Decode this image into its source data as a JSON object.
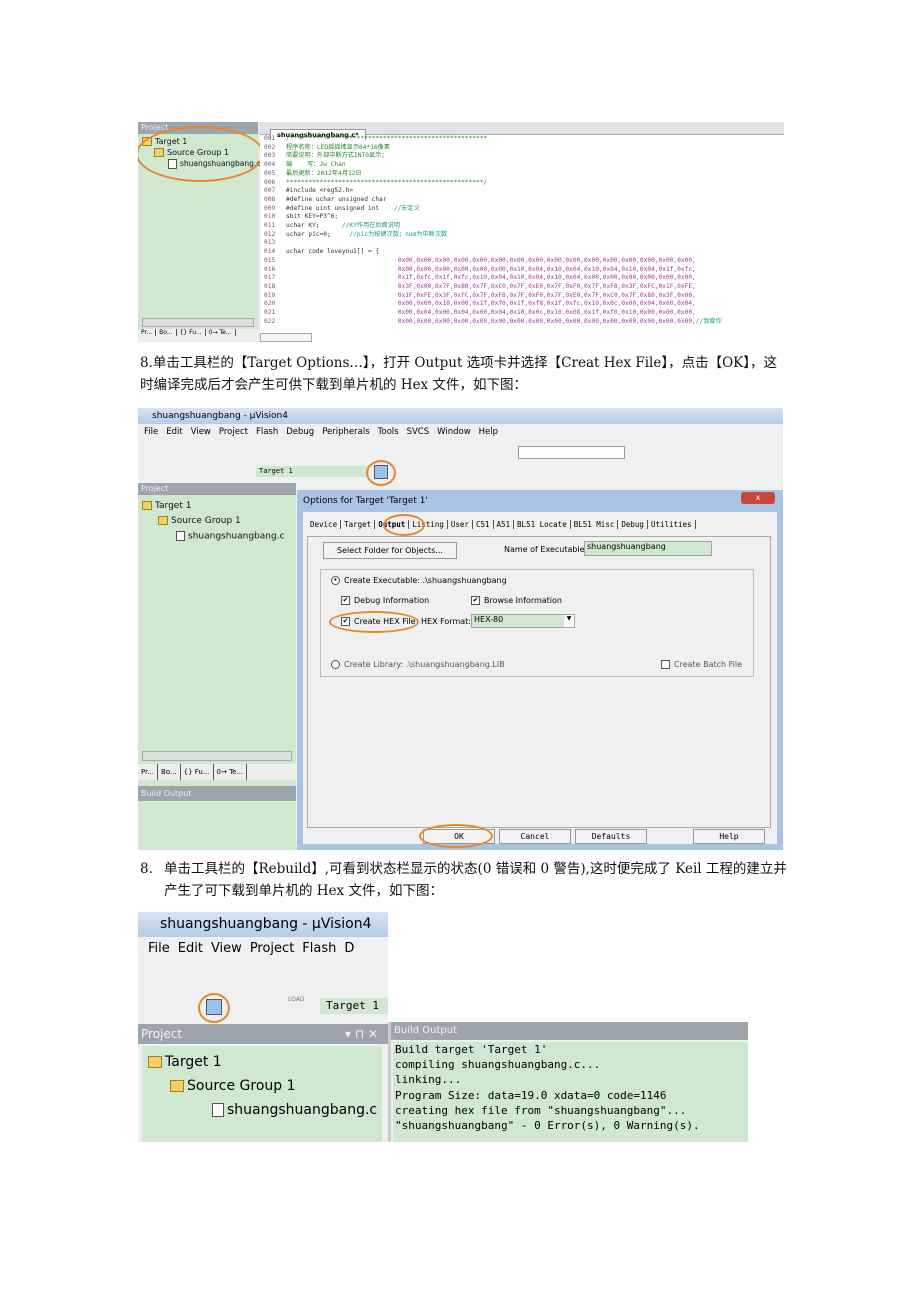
{
  "shot1": {
    "panel_title": "Project",
    "tree": [
      "Target 1",
      "Source Group 1",
      "shuangshuangbang.c"
    ],
    "bottom_tabs": [
      "Pr...",
      "Bo...",
      "{} Fu...",
      "0→ Te..."
    ],
    "file_tab": "shuangshuangbang.c*",
    "code": [
      {
        "n": "001",
        "kind": "cmt",
        "text": "/*****************************************************",
        "c": ""
      },
      {
        "n": "002",
        "kind": "cmt",
        "text": "程序名称：LED摇摇棒显示64*16像素",
        "c": ""
      },
      {
        "n": "003",
        "kind": "cmt",
        "text": "简要说明：外部中断方式INT0显示；",
        "c": ""
      },
      {
        "n": "004",
        "kind": "cmt",
        "text": "编    写：Jw Chan",
        "c": ""
      },
      {
        "n": "005",
        "kind": "cmt",
        "text": "最后更新：2012年4月12日",
        "c": ""
      },
      {
        "n": "006",
        "kind": "cmt",
        "text": "*****************************************************/",
        "c": ""
      },
      {
        "n": "007",
        "kind": "code",
        "text": "#include <reg52.h>",
        "c": ""
      },
      {
        "n": "008",
        "kind": "code",
        "text": "#define uchar unsigned char",
        "c": ""
      },
      {
        "n": "009",
        "kind": "code",
        "text": "#define uint unsigned int    ",
        "c": "//宏定义"
      },
      {
        "n": "010",
        "kind": "code",
        "text": "sbit KEY=P3^6;",
        "c": ""
      },
      {
        "n": "011",
        "kind": "code",
        "text": "uchar KY;      ",
        "c": "//KY作用在后面说明"
      },
      {
        "n": "012",
        "kind": "code",
        "text": "uchar pic=0;     ",
        "c": "//pic为按键次数；num为中断次数"
      },
      {
        "n": "013",
        "kind": "code",
        "text": "",
        "c": ""
      },
      {
        "n": "014",
        "kind": "code",
        "text": "uchar code loveyou1[] = {",
        "c": ""
      },
      {
        "n": "015",
        "kind": "hex",
        "text": "                              0x00,0x00,0x00,0x00,0x00,0x00,0x00,0x00,0x00,0x00,0x00,0x00,0x00,0x00,0x00,0x00,",
        "c": ""
      },
      {
        "n": "016",
        "kind": "hex",
        "text": "                              0x00,0x00,0x00,0x00,0x00,0x00,0x10,0x04,0x10,0x04,0x10,0x04,0x10,0x04,0x1f,0xfc,",
        "c": ""
      },
      {
        "n": "017",
        "kind": "hex",
        "text": "                              0x1f,0xfc,0x1f,0xfc,0x10,0x04,0x10,0x04,0x10,0x04,0x00,0x00,0x00,0x00,0x00,0x00,",
        "c": ""
      },
      {
        "n": "018",
        "kind": "hex",
        "text": "                              0x3F,0x00,0x7F,0x80,0x7F,0xC0,0x7F,0xE0,0x7F,0xF0,0x7F,0xF8,0x3F,0xFC,0x1F,0xFE,",
        "c": ""
      },
      {
        "n": "019",
        "kind": "hex",
        "text": "                              0x1F,0xFE,0x3F,0xFC,0x7F,0xF8,0x7F,0xF0,0x7F,0xE0,0x7F,0xC0,0x7F,0x80,0x3F,0x00,",
        "c": ""
      },
      {
        "n": "020",
        "kind": "hex",
        "text": "                              0x00,0x00,0x10,0x00,0x1f,0xf0,0x1f,0xf8,0x1f,0xfc,0x10,0x0c,0x00,0x04,0x00,0x04,",
        "c": ""
      },
      {
        "n": "021",
        "kind": "hex",
        "text": "                              0x00,0x04,0x00,0x04,0x00,0x04,0x10,0x0c,0x10,0x08,0x1f,0xf0,0x10,0x00,0x00,0x00,",
        "c": ""
      },
      {
        "n": "022",
        "kind": "hex",
        "text": "                              0x00,0x00,0x00,0x00,0x00,0x00,0x00,0x00,0x00,0x00,0x00,0x00,0x00,0x00,0x00,0x00,",
        "c": "//我爱你"
      }
    ]
  },
  "para1": "8.单击工具栏的【Target Options…】，打开 Output 选项卡并选择【Creat Hex File】，点击【OK】，这时编译完成后才会产生可供下载到单片机的 Hex 文件，如下图：",
  "shot2": {
    "title": "shuangshuangbang - µVision4",
    "menu": [
      "File",
      "Edit",
      "View",
      "Project",
      "Flash",
      "Debug",
      "Peripherals",
      "Tools",
      "SVCS",
      "Window",
      "Help"
    ],
    "target_select": "Target 1",
    "panel_title": "Project",
    "tree": [
      "Target 1",
      "Source Group 1",
      "shuangshuangbang.c"
    ],
    "bottom_tabs": [
      "Pr...",
      "Bo...",
      "{} Fu...",
      "0→ Te..."
    ],
    "build_output_title": "Build Output",
    "dialog": {
      "title": "Options for Target 'Target 1'",
      "close": "x",
      "tabs": [
        "Device",
        "Target",
        "Output",
        "Listing",
        "User",
        "C51",
        "A51",
        "BL51 Locate",
        "BL51 Misc",
        "Debug",
        "Utilities"
      ],
      "active_tab": "Output",
      "select_folder": "Select Folder for Objects...",
      "name_label": "Name of Executable:",
      "name_value": "shuangshuangbang",
      "create_exe": "Create Executable:  .\\shuangshuangbang",
      "debug_info": "Debug Information",
      "browse_info": "Browse Information",
      "create_hex": "Create HEX File",
      "hex_format_label": "HEX Format:",
      "hex_format_value": "HEX-80",
      "create_lib": "Create Library:  .\\shuangshuangbang.LIB",
      "create_batch": "Create Batch File",
      "buttons": [
        "OK",
        "Cancel",
        "Defaults",
        "Help"
      ]
    }
  },
  "para2": {
    "num": "8.",
    "text": "单击工具栏的【Rebuild】,可看到状态栏显示的状态(0 错误和 0 警告),这时便完成了 Keil 工程的建立并产生了可下载到单片机的 Hex 文件，如下图："
  },
  "shot3": {
    "title": "shuangshuangbang - µVision4",
    "menu": [
      "File",
      "Edit",
      "View",
      "Project",
      "Flash",
      "D"
    ],
    "load_label": "LOAD",
    "target_select": "Target 1",
    "panel_title": "Project",
    "tree": [
      "Target 1",
      "Source Group 1",
      "shuangshuangbang.c"
    ],
    "build_output_title": "Build Output",
    "build_lines": [
      "Build target 'Target 1'",
      "compiling shuangshuangbang.c...",
      "linking...",
      "Program Size: data=19.0 xdata=0 code=1146",
      "creating hex file from \"shuangshuangbang\"...",
      "\"shuangshuangbang\" - 0 Error(s), 0 Warning(s)."
    ]
  },
  "colors": {
    "panel_green": "#cfe8cf",
    "highlight_ring": "#e8862a",
    "titlebar": "#bcd3ee"
  }
}
